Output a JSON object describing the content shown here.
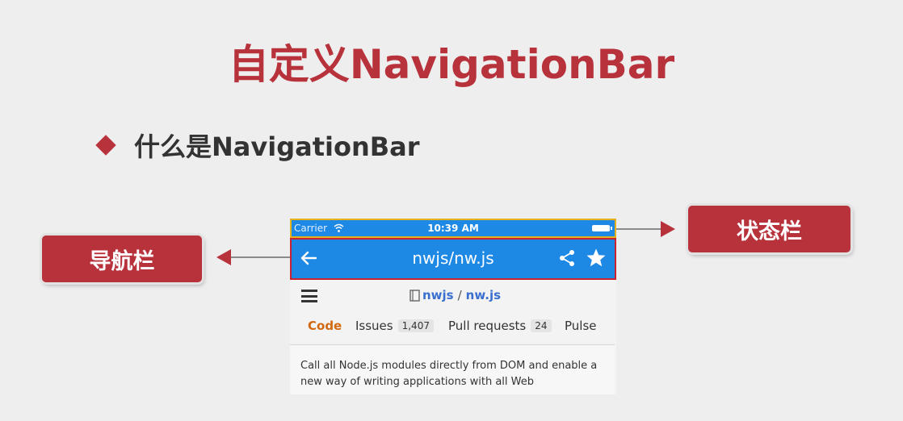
{
  "slide": {
    "title": "自定义NavigationBar",
    "bullet": "什么是NavigationBar"
  },
  "callouts": {
    "nav_bar_label": "导航栏",
    "status_bar_label": "状态栏"
  },
  "phone": {
    "status_bar": {
      "carrier": "Carrier",
      "time": "10:39 AM",
      "icons": [
        "wifi-icon",
        "battery-icon"
      ]
    },
    "nav_bar": {
      "title": "nwjs/nw.js",
      "icons": [
        "back-arrow-icon",
        "share-icon",
        "star-icon"
      ]
    },
    "repo": {
      "owner": "nwjs",
      "separator": "/",
      "name": "nw.js",
      "icons": [
        "menu-icon",
        "book-icon"
      ]
    },
    "tabs": [
      {
        "label": "Code",
        "count": ""
      },
      {
        "label": "Issues",
        "count": "1,407"
      },
      {
        "label": "Pull requests",
        "count": "24"
      },
      {
        "label": "Pulse",
        "count": ""
      }
    ],
    "description": "Call all Node.js modules directly from DOM and enable a new way of writing applications with all Web"
  },
  "colors": {
    "accent_red": "#b8323c",
    "nav_blue": "#1e88e5",
    "status_outline": "#e3b21c",
    "nav_outline": "#c8232f",
    "active_tab": "#d26911"
  }
}
